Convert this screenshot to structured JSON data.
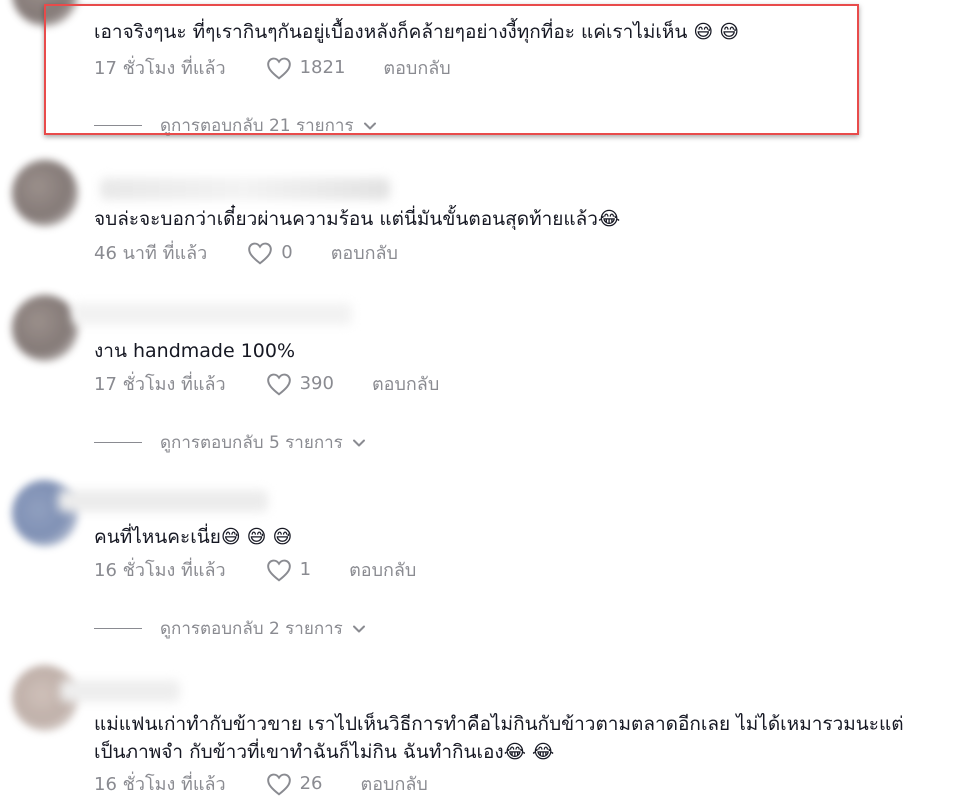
{
  "comments": [
    {
      "text": "เอาจริงๆนะ ที่ๆเรากินๆกันอยู่เบื้องหลังก็คล้ายๆอย่างงี้ทุกที่อะ แค่เราไม่เห็น 😅 😅",
      "time": "17 ชั่วโมง ที่แล้ว",
      "likes": "1821",
      "reply_label": "ตอบกลับ",
      "view_replies": "ดูการตอบกลับ 21 รายการ"
    },
    {
      "text": "จบล่ะจะบอกว่าเดี๋ยวผ่านความร้อน แต่นี่มันขั้นตอนสุดท้ายแล้ว😂",
      "time": "46 นาที ที่แล้ว",
      "likes": "0",
      "reply_label": "ตอบกลับ"
    },
    {
      "text": "งาน handmade 100%",
      "time": "17 ชั่วโมง ที่แล้ว",
      "likes": "390",
      "reply_label": "ตอบกลับ",
      "view_replies": "ดูการตอบกลับ 5 รายการ"
    },
    {
      "text": "คนที่ไหนคะเนี่ย😅 😅 😅",
      "time": "16 ชั่วโมง ที่แล้ว",
      "likes": "1",
      "reply_label": "ตอบกลับ",
      "view_replies": "ดูการตอบกลับ 2 รายการ"
    },
    {
      "text_line1": "แม่แฟนเก่าทำกับข้าวขาย เราไปเห็นวิธีการทำคือไม่กินกับข้าวตามตลาดอีกเลย ไม่ได้เหมารวมนะแต่",
      "text_line2": "เป็นภาพจำ กับข้าวที่เขาทำฉันก็ไม่กิน ฉันทำกินเอง😂 😂",
      "time": "16 ชั่วโมง ที่แล้ว",
      "likes": "26",
      "reply_label": "ตอบกลับ"
    }
  ],
  "icons": {
    "like": "heart-outline-icon",
    "expand": "chevron-down-icon"
  },
  "colors": {
    "text": "#161823",
    "meta": "#8a8b91",
    "highlight": "#e84b4b"
  }
}
